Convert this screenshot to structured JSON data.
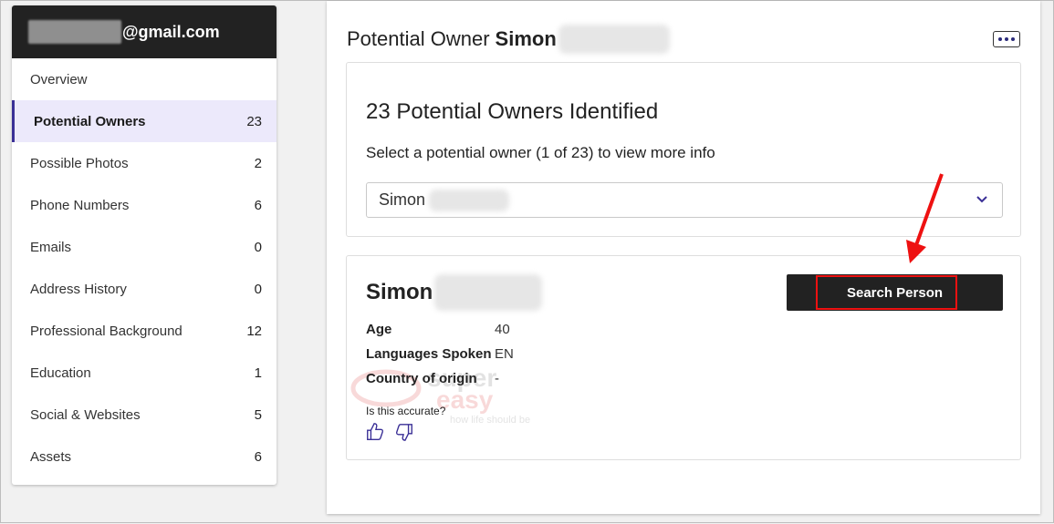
{
  "sidebar": {
    "email_suffix": "@gmail.com",
    "items": [
      {
        "label": "Overview",
        "count": ""
      },
      {
        "label": "Potential Owners",
        "count": "23"
      },
      {
        "label": "Possible Photos",
        "count": "2"
      },
      {
        "label": "Phone Numbers",
        "count": "6"
      },
      {
        "label": "Emails",
        "count": "0"
      },
      {
        "label": "Address History",
        "count": "0"
      },
      {
        "label": "Professional Background",
        "count": "12"
      },
      {
        "label": "Education",
        "count": "1"
      },
      {
        "label": "Social & Websites",
        "count": "5"
      },
      {
        "label": "Assets",
        "count": "6"
      }
    ],
    "active_index": 1,
    "active_color": "#3a2f96"
  },
  "main": {
    "title_prefix": "Potential Owner",
    "title_name": "Simon",
    "more_icon": "ellipsis-icon",
    "summary": {
      "heading": "23 Potential Owners Identified",
      "subheading": "Select a potential owner (1 of 23) to view more info",
      "select_value": "Simon"
    },
    "person": {
      "name": "Simon",
      "search_button": "Search Person",
      "fields": [
        {
          "label": "Age",
          "value": "40"
        },
        {
          "label": "Languages Spoken",
          "value": "EN"
        },
        {
          "label": "Country of origin",
          "value": "-"
        }
      ],
      "accuracy_prompt": "Is this accurate?"
    }
  },
  "watermark": {
    "line1": "super",
    "line2": "easy",
    "tagline": "how life should be"
  },
  "colors": {
    "annotation_red": "#e11111",
    "dark": "#222222"
  }
}
